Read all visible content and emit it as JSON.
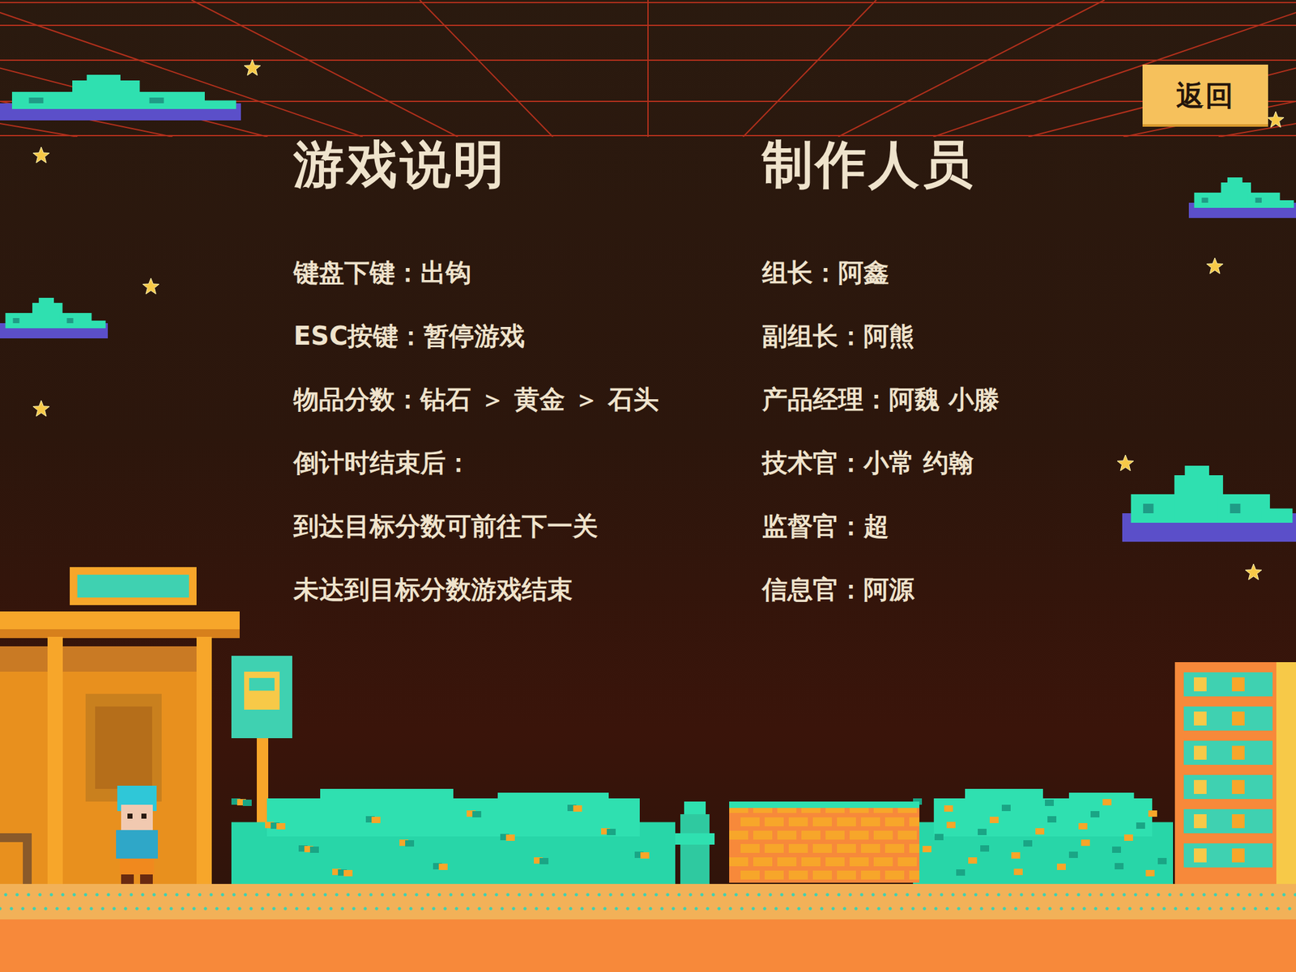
{
  "back_button": "返回",
  "instructions": {
    "title": "游戏说明",
    "lines": [
      "键盘下键：出钩",
      "ESC按键：暂停游戏",
      "物品分数：钻石 ＞ 黄金 ＞ 石头",
      "倒计时结束后：",
      "到达目标分数可前往下一关",
      "未达到目标分数游戏结束"
    ]
  },
  "credits": {
    "title": "制作人员",
    "lines": [
      "组长：阿鑫",
      "副组长：阿熊",
      "产品经理：阿魏 小滕",
      "技术官：小常 约翰",
      "监督官：超",
      "信息官：阿源"
    ]
  }
}
